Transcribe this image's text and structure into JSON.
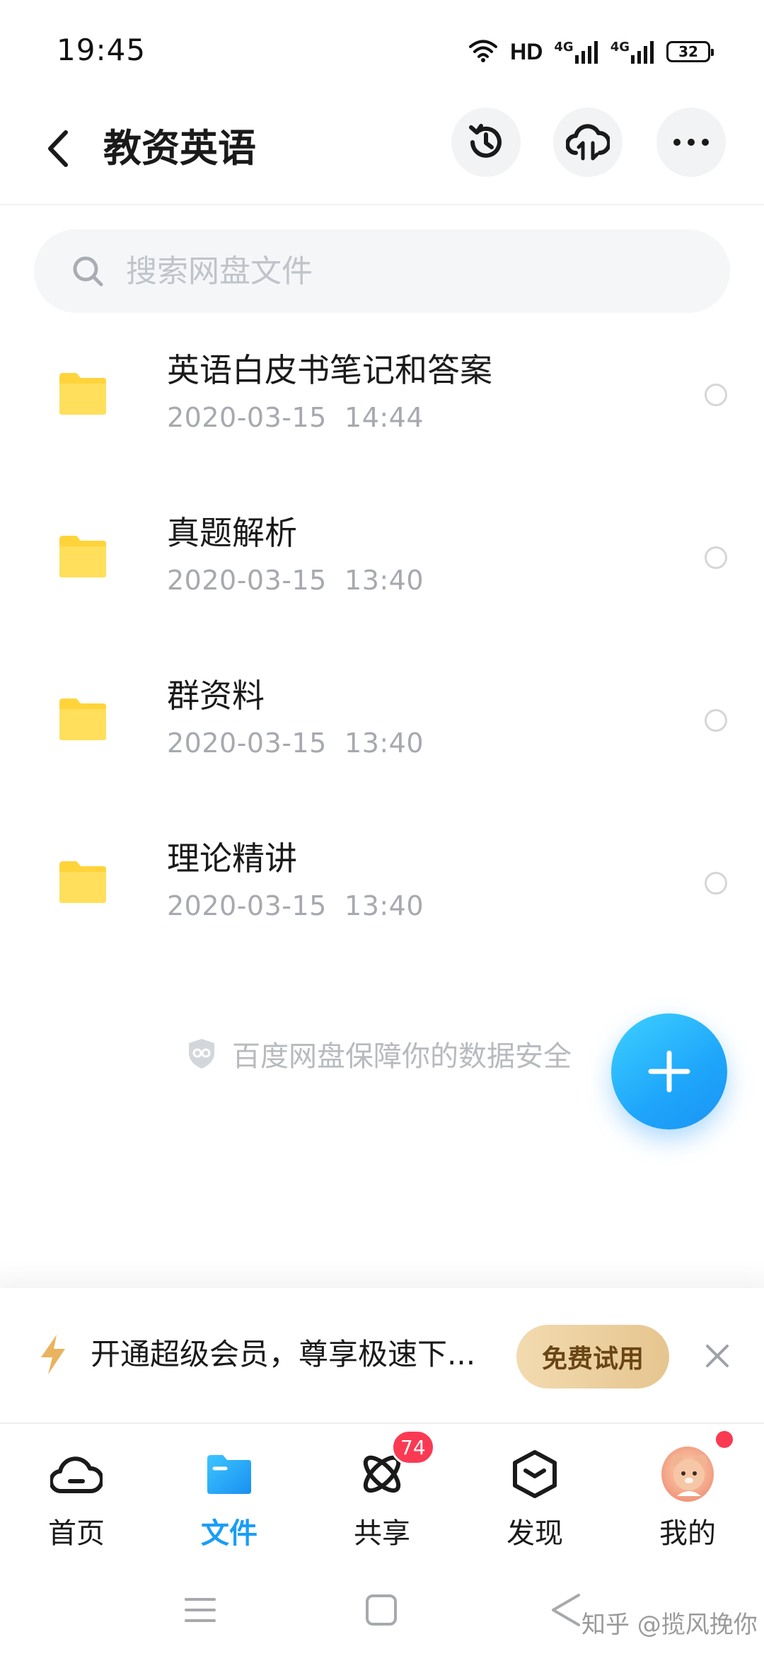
{
  "status_bar": {
    "time": "19:45",
    "network_label": "HD",
    "signal_1": "4G",
    "signal_2": "4G",
    "battery": "32",
    "icons": [
      "wifi-icon",
      "signal-icon",
      "signal-icon",
      "battery-icon"
    ]
  },
  "header": {
    "title": "教资英语",
    "icons": [
      "back-arrow-icon",
      "history-icon",
      "cloud-transfer-icon",
      "more-icon"
    ]
  },
  "search": {
    "placeholder": "搜索网盘文件",
    "icon": "search-icon"
  },
  "files": [
    {
      "name": "英语白皮书笔记和答案",
      "date": "2020-03-15",
      "time": "14:44",
      "icon": "folder-icon"
    },
    {
      "name": "真题解析",
      "date": "2020-03-15",
      "time": "13:40",
      "icon": "folder-icon"
    },
    {
      "name": "群资料",
      "date": "2020-03-15",
      "time": "13:40",
      "icon": "folder-icon"
    },
    {
      "name": "理论精讲",
      "date": "2020-03-15",
      "time": "13:40",
      "icon": "folder-icon"
    }
  ],
  "security_note": "百度网盘保障你的数据安全",
  "promo": {
    "text": "开通超级会员，尊享极速下...",
    "button": "免费试用",
    "icon": "lightning-icon"
  },
  "tabs": [
    {
      "label": "首页",
      "icon": "cloud-home-icon",
      "active": false
    },
    {
      "label": "文件",
      "icon": "folder-icon",
      "active": true
    },
    {
      "label": "共享",
      "icon": "share-orbit-icon",
      "active": false,
      "badge": "74"
    },
    {
      "label": "发现",
      "icon": "discover-cube-icon",
      "active": false
    },
    {
      "label": "我的",
      "icon": "avatar",
      "active": false
    }
  ],
  "watermark": "知乎 @揽风挽你",
  "colors": {
    "accent": "#1a9ef5",
    "folder": "#ffd43b",
    "badge": "#fa3a53",
    "promo_button": "#e9cb98"
  }
}
